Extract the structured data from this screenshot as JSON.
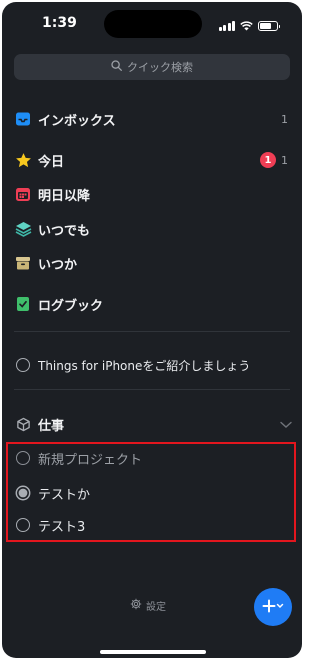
{
  "status_bar": {
    "time": "1:39"
  },
  "search": {
    "placeholder": "クイック検索"
  },
  "lists": {
    "inbox": {
      "label": "インボックス",
      "count": "1"
    },
    "today": {
      "label": "今日",
      "badge": "1",
      "count": "1"
    },
    "upcoming": {
      "label": "明日以降"
    },
    "anytime": {
      "label": "いつでも"
    },
    "someday": {
      "label": "いつか"
    },
    "logbook": {
      "label": "ログブック"
    }
  },
  "intro_project": {
    "label": "Things for iPhoneをご紹介しましょう"
  },
  "area": {
    "label": "仕事"
  },
  "projects": [
    {
      "label": "新規プロジェクト"
    },
    {
      "label": "テストか"
    },
    {
      "label": "テスト3"
    }
  ],
  "footer": {
    "settings_label": "設定"
  },
  "colors": {
    "background": "#1c1f24",
    "accent": "#1f7cf5",
    "badge": "#ef3e55",
    "highlight": "#e3161e"
  }
}
